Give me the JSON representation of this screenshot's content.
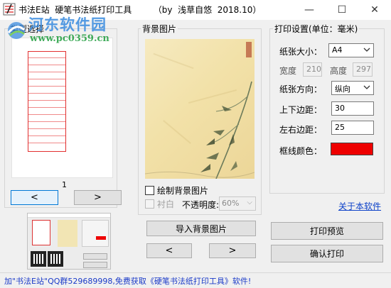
{
  "window": {
    "title_main": "书法E站  硬笔书法纸打印工具",
    "title_credit": "（by  浅草自悠  2018.10）",
    "controls": {
      "minimize": "—",
      "maximize": "☐",
      "close": "✕"
    }
  },
  "watermark": {
    "name": "河东软件园",
    "url": "www.pc0359.cn"
  },
  "type_panel": {
    "legend": "类型选择",
    "page_number": "1",
    "prev_label": "<",
    "next_label": ">"
  },
  "background_panel": {
    "legend": "背景图片",
    "draw_background_label": "绘制背景图片",
    "draw_background_checked": false,
    "liner_label": "衬白",
    "liner_checked": false,
    "opacity_label": "不透明度:",
    "opacity_value": "60%",
    "import_button": "导入背景图片",
    "prev_label": "<",
    "next_label": ">"
  },
  "print_panel": {
    "legend": "打印设置(单位：毫米)",
    "paper_size_label": "纸张大小：",
    "paper_size_value": "A4",
    "width_label": "宽度",
    "width_value": "210",
    "height_label": "高度",
    "height_value": "297",
    "orientation_label": "纸张方向：",
    "orientation_value": "纵向",
    "tb_margin_label": "上下边距：",
    "tb_margin_value": "30",
    "lr_margin_label": "左右边距：",
    "lr_margin_value": "25",
    "frame_color_label": "框线颜色：",
    "frame_color": "#EE0000"
  },
  "about_link": "关于本软件",
  "actions": {
    "preview": "打印预览",
    "print": "确认打印"
  },
  "status": "加\"书法E站\"QQ群529689998,免费获取《硬笔书法纸打印工具》软件!",
  "icons": {
    "app": "app-icon",
    "dropdown": "chevron-down-icon"
  }
}
